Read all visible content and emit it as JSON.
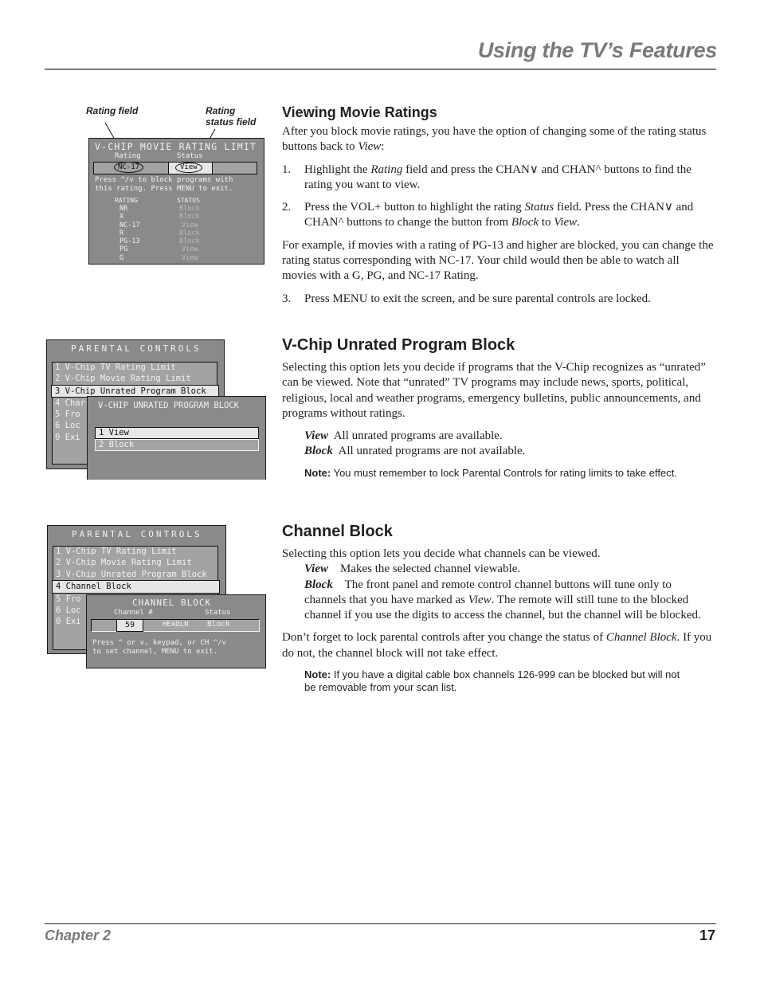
{
  "header": {
    "title": "Using the TV’s Features"
  },
  "footer": {
    "chapter": "Chapter 2",
    "page": "17"
  },
  "figure1": {
    "callouts": {
      "rating_field": "Rating field",
      "rating_status_field_1": "Rating",
      "rating_status_field_2": "status field"
    },
    "title": "V-CHIP MOVIE RATING LIMIT",
    "col_rating": "Rating",
    "col_status": "Status",
    "rating_value": "NC-17",
    "status_value": "View",
    "instructions_1": "Press ^/v to block programs with",
    "instructions_2": "this rating. Press MENU to exit.",
    "table_header_rating": "RATING",
    "table_header_status": "STATUS",
    "rows": [
      {
        "rating": "NR",
        "status": "Block"
      },
      {
        "rating": "X",
        "status": "Block"
      },
      {
        "rating": "NC-17",
        "status": "View"
      },
      {
        "rating": "R",
        "status": "Block"
      },
      {
        "rating": "PG-13",
        "status": "Block"
      },
      {
        "rating": "PG",
        "status": "View"
      },
      {
        "rating": "G",
        "status": "View"
      }
    ]
  },
  "figure2": {
    "menu_title": "PARENTAL CONTROLS",
    "menu_items": [
      "1 V-Chip TV Rating Limit",
      "2 V-Chip Movie Rating Limit",
      "3 V-Chip Unrated Program Block",
      "4 Char",
      "5 Fro",
      "6 Loc",
      "0 Exi"
    ],
    "selected_index": 2,
    "sub_title": "V-CHIP UNRATED PROGRAM BLOCK",
    "sub_options": [
      "1 View",
      "2 Block"
    ]
  },
  "figure3": {
    "menu_title": "PARENTAL CONTROLS",
    "menu_items": [
      "1 V-Chip TV Rating Limit",
      "2 V-Chip Movie Rating Limit",
      "3 V-Chip Unrated Program Block",
      "4 Channel Block",
      "5 Fro",
      "6 Loc",
      "0 Exi"
    ],
    "selected_index": 3,
    "sub_title": "CHANNEL BLOCK",
    "col_channel": "Channel #",
    "col_status": "Status",
    "channel_value": "59",
    "channel_name": "HEADLN",
    "status_value": "Block",
    "instructions_1": "Press ^ or v, keypad, or CH ^/v",
    "instructions_2": "to set channel, MENU to exit."
  },
  "section1": {
    "heading": "Viewing Movie Ratings",
    "intro_a": "After you block movie ratings, you have the option of changing some of the rating status buttons back to ",
    "intro_b": "View",
    "intro_c": ":",
    "steps": [
      {
        "n": "1.",
        "a": "Highlight the ",
        "b": "Rating",
        "c": " field and press the CHAN∨ and CHAN^ buttons to find the rating you want to view."
      },
      {
        "n": "2.",
        "a": "Press the VOL+ button to highlight the rating ",
        "b": "Status",
        "c": " field. Press the CHAN∨ and CHAN^ buttons to change the button from ",
        "d": "Block",
        "e": "  to ",
        "f": "View",
        "g": "."
      }
    ],
    "example": "For example, if movies with a rating of PG-13 and higher are blocked, you can change the rating status corresponding with NC-17. Your child would then be able to watch all movies with a G, PG, and NC-17 Rating.",
    "step3": {
      "n": "3.",
      "text": "Press MENU to exit the screen, and be sure parental controls are locked."
    }
  },
  "section2": {
    "heading": "V-Chip Unrated Program Block",
    "intro": "Selecting this option lets you decide if programs that the V-Chip recognizes as “unrated” can be viewed. Note that “unrated” TV  programs may include news, sports, political, religious, local and weather programs, emergency bulletins, public announcements, and programs without ratings.",
    "options": [
      {
        "term": "View",
        "desc": "All unrated programs are available."
      },
      {
        "term": "Block",
        "desc": "All unrated programs are not available."
      }
    ],
    "note_label": "Note:",
    "note_text": " You must remember to lock Parental Controls for rating limits to take effect."
  },
  "section3": {
    "heading": "Channel Block",
    "intro": "Selecting this option lets you decide what channels can be viewed.",
    "view_term": "View",
    "view_desc": "Makes the selected channel viewable.",
    "block_term": "Block",
    "block_desc_a": "The front panel and remote control channel buttons will tune only to channels that you have marked as ",
    "block_desc_b": "View",
    "block_desc_c": ". The remote will still tune to the blocked channel if you use the digits to access the channel, but the channel will be blocked.",
    "reminder_a": "Don’t forget to lock parental controls after you change the status of ",
    "reminder_b": "Channel Block",
    "reminder_c": ". If you do not, the channel block will not take effect.",
    "note_label": "Note:",
    "note_text": " If you have a digital cable box channels 126-999 can be blocked but will not be removable from your scan list."
  }
}
